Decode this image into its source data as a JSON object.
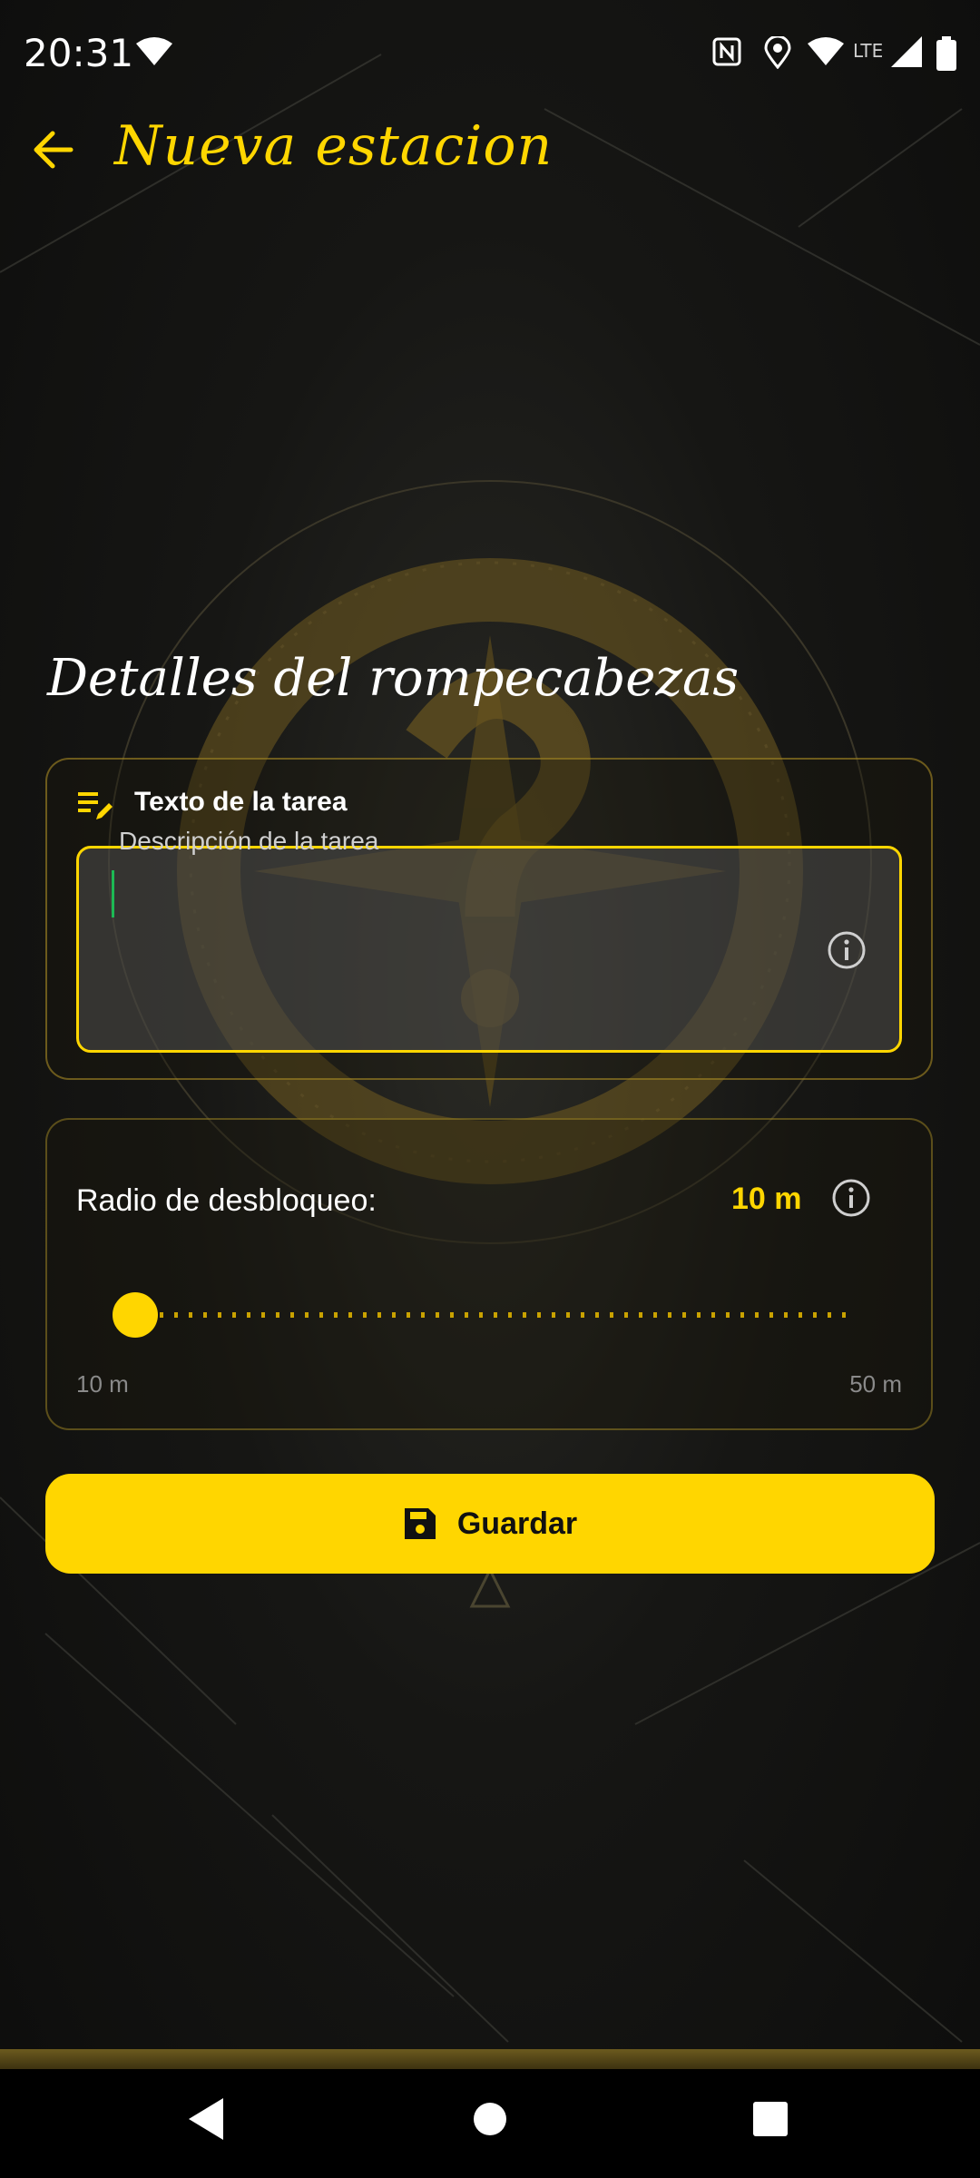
{
  "status_bar": {
    "time": "20:31",
    "network_label": "LTE",
    "icons": [
      "wifi-icon",
      "nfc-icon",
      "location-icon",
      "wifi-icon",
      "cell-signal-icon",
      "battery-icon"
    ]
  },
  "app_bar": {
    "title": "Nueva estacion",
    "back_icon": "arrow-back-icon"
  },
  "section": {
    "title": "Detalles del rompecabezas"
  },
  "task": {
    "header_label": "Texto de la tarea",
    "field_label": "Descripción de la tarea",
    "field_value": ""
  },
  "radius": {
    "label": "Radio de desbloqueo:",
    "value_text": "10 m",
    "min_label": "10 m",
    "max_label": "50 m",
    "min": 10,
    "max": 50,
    "value": 10
  },
  "save_button": {
    "label": "Guardar",
    "icon": "save-icon"
  },
  "colors": {
    "accent": "#FFD600",
    "background": "#121212"
  }
}
